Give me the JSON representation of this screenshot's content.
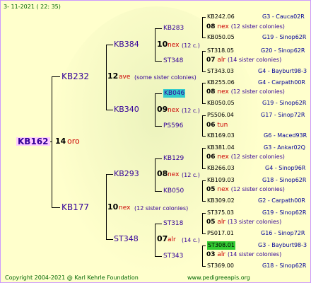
{
  "header": {
    "date": "3- 11-2021 ( 22: 35)"
  },
  "footer": {
    "copyright": "Copyright 2004-2021 @ Karl Kehrle Foundation",
    "site": "www.pedigreeapis.org"
  },
  "colors": {
    "background": "#ffffcc",
    "highlight_cyan": "#33cccc",
    "highlight_green": "#33cc33",
    "frame": "#cc99ff"
  },
  "gen0": {
    "name": "KB162",
    "num": "14",
    "race": "oro"
  },
  "gen1": [
    {
      "name": "KB232",
      "num": "12",
      "race": "ave",
      "note": "(some sister colonies)"
    },
    {
      "name": "KB177",
      "num": "10",
      "race": "nex",
      "note": "(12 sister colonies)"
    }
  ],
  "gen2": [
    {
      "name": "KB384",
      "num": "10",
      "race": "nex",
      "note": "(12 c.)"
    },
    {
      "name": "KB340",
      "num": "09",
      "race": "nex",
      "note": "(12 c.)"
    },
    {
      "name": "KB293",
      "num": "08",
      "race": "nex",
      "note": "(12 c.)"
    },
    {
      "name": "ST348",
      "num": "07",
      "race": "alr",
      "note": "(14 c.)"
    }
  ],
  "gen3": [
    {
      "name": "KB283",
      "num": "08",
      "race": "nex",
      "note": "(12 sister colonies)"
    },
    {
      "name": "ST348",
      "num": "07",
      "race": "alr",
      "note": "(14 sister colonies)"
    },
    {
      "name": "KB046",
      "num": "08",
      "race": "nex",
      "note": "(12 sister colonies)"
    },
    {
      "name": "PS596",
      "num": "06",
      "race": "tun",
      "note": ""
    },
    {
      "name": "KB129",
      "num": "06",
      "race": "nex",
      "note": "(12 sister colonies)"
    },
    {
      "name": "KB050",
      "num": "05",
      "race": "nex",
      "note": "(12 sister colonies)"
    },
    {
      "name": "ST318",
      "num": "05",
      "race": "alr",
      "note": "(13 sister colonies)"
    },
    {
      "name": "ST343",
      "num": "03",
      "race": "alr",
      "note": "(14 sister colonies)"
    }
  ],
  "gen4": [
    {
      "name": "KB242.06",
      "loc": "G3 - Cauca02R"
    },
    {
      "name": "KB050.05",
      "loc": "G19 - Sinop62R"
    },
    {
      "name": "ST318.05",
      "loc": "G20 - Sinop62R"
    },
    {
      "name": "ST343.03",
      "loc": "G4 - Bayburt98-3"
    },
    {
      "name": "KB255.06",
      "loc": "G4 - Carpath00R"
    },
    {
      "name": "KB050.05",
      "loc": "G19 - Sinop62R"
    },
    {
      "name": "PS506.04",
      "loc": "G17 - Sinop72R"
    },
    {
      "name": "KB169.03",
      "loc": "G6 - Maced93R"
    },
    {
      "name": "KB381.04",
      "loc": "G3 - Ankar02Q"
    },
    {
      "name": "KB266.03",
      "loc": "G4 - Sinop96R"
    },
    {
      "name": "KB109.03",
      "loc": "G18 - Sinop62R"
    },
    {
      "name": "KB309.02",
      "loc": "G2 - Carpath00R"
    },
    {
      "name": "ST375.03",
      "loc": "G19 - Sinop62R"
    },
    {
      "name": "PS017.01",
      "loc": "G16 - Sinop72R"
    },
    {
      "name": "ST308.01",
      "loc": "G3 - Bayburt98-3"
    },
    {
      "name": "ST369.00",
      "loc": "G18 - Sinop62R"
    }
  ]
}
